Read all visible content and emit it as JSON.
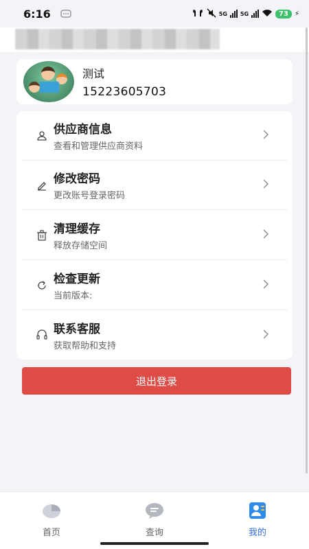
{
  "status_bar": {
    "time": "6:16",
    "battery": "73",
    "network_1": "5G",
    "network_2": "5G"
  },
  "profile": {
    "name": "测试",
    "phone": "15223605703"
  },
  "menu": {
    "items": [
      {
        "icon": "user-icon",
        "title": "供应商信息",
        "subtitle": "查看和管理供应商资料"
      },
      {
        "icon": "edit-icon",
        "title": "修改密码",
        "subtitle": "更改账号登录密码"
      },
      {
        "icon": "trash-icon",
        "title": "清理缓存",
        "subtitle": "释放存储空间"
      },
      {
        "icon": "refresh-icon",
        "title": "检查更新",
        "subtitle": "当前版本:"
      },
      {
        "icon": "headset-icon",
        "title": "联系客服",
        "subtitle": "获取帮助和支持"
      }
    ]
  },
  "logout": {
    "label": "退出登录",
    "color": "#de4c45"
  },
  "bottom_nav": {
    "items": [
      {
        "icon": "pie-chart-icon",
        "label": "首页"
      },
      {
        "icon": "chat-bubble-icon",
        "label": "查询"
      },
      {
        "icon": "profile-card-icon",
        "label": "我的",
        "active": true
      }
    ],
    "active_color": "#2f6fe4"
  }
}
